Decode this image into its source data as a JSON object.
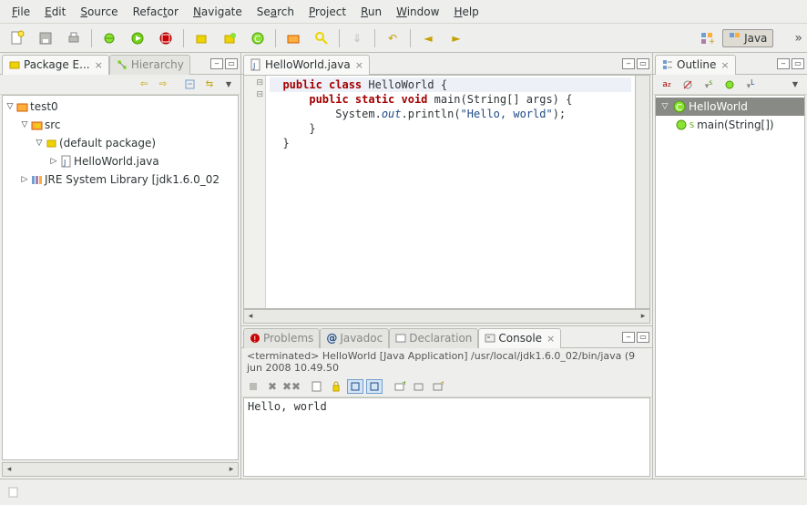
{
  "menubar": [
    "File",
    "Edit",
    "Source",
    "Refactor",
    "Navigate",
    "Search",
    "Project",
    "Run",
    "Window",
    "Help"
  ],
  "menubar_mnemonic": [
    "F",
    "E",
    "S",
    "R",
    "N",
    "a",
    "P",
    "R",
    "W",
    "H"
  ],
  "perspective": {
    "active": "Java"
  },
  "left_panel": {
    "tabs": [
      "Package E...",
      "Hierarchy"
    ],
    "active_tab": 0,
    "tree": {
      "project": "test0",
      "src": "src",
      "pkg": "(default package)",
      "file": "HelloWorld.java",
      "jre": "JRE System Library [jdk1.6.0_02"
    }
  },
  "editor": {
    "tab_label": "HelloWorld.java",
    "lines": [
      "public class HelloWorld {",
      "    public static void main(String[] args) {",
      "        System.out.println(\"Hello, world\");",
      "    }",
      "}"
    ]
  },
  "outline": {
    "title": "Outline",
    "items": [
      {
        "label": "HelloWorld",
        "kind": "class",
        "selected": true
      },
      {
        "label": "main(String[])",
        "kind": "method",
        "selected": false
      }
    ]
  },
  "bottom": {
    "tabs": [
      "Problems",
      "Javadoc",
      "Declaration",
      "Console"
    ],
    "active_tab": 3,
    "console_status": "<terminated> HelloWorld [Java Application] /usr/local/jdk1.6.0_02/bin/java (9 jun 2008 10.49.50",
    "console_output": "Hello, world"
  }
}
